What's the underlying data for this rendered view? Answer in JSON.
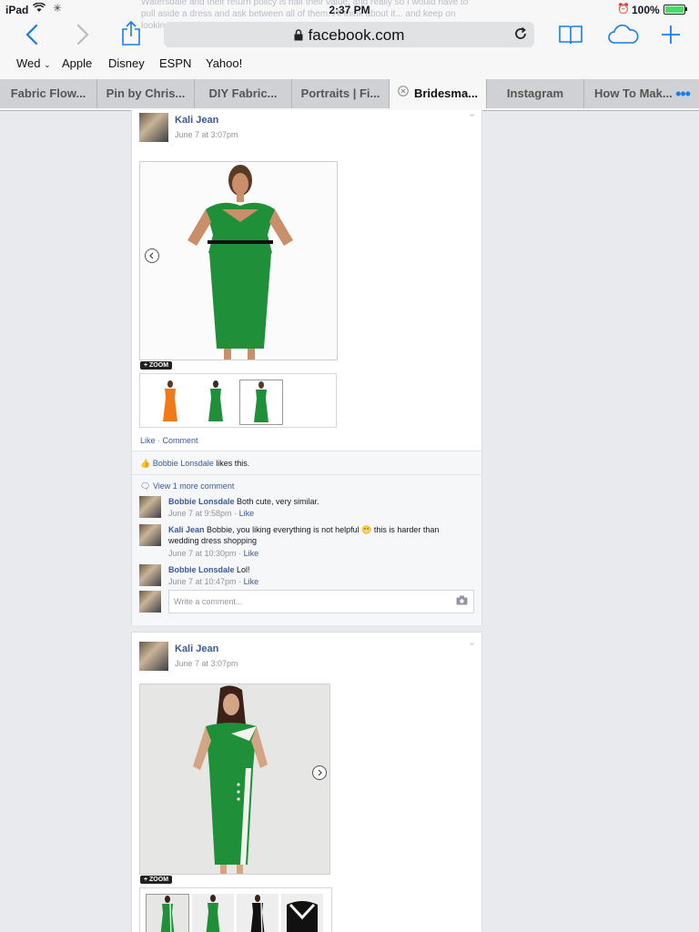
{
  "status_bar": {
    "device": "iPad",
    "time": "2:37 PM",
    "battery": "100%",
    "battery_level": 1.0
  },
  "browser": {
    "address": "facebook.com",
    "background_text": "Watersdale and their return policy is half their value, and really so I would have to pull aside a dress and ask between all of them. I'll think about it... and keep on looking meantime..."
  },
  "favorites": [
    {
      "label": "Wed",
      "has_dropdown": true
    },
    {
      "label": "Apple"
    },
    {
      "label": "Disney"
    },
    {
      "label": "ESPN"
    },
    {
      "label": "Yahoo!"
    }
  ],
  "tabs": [
    {
      "label": "Fabric Flow..."
    },
    {
      "label": "Pin by Chris..."
    },
    {
      "label": "DIY Fabric..."
    },
    {
      "label": "Portraits | Fi..."
    },
    {
      "label": "Bridesma...",
      "active": true
    },
    {
      "label": "Instagram"
    },
    {
      "label": "How To Mak..."
    }
  ],
  "posts": [
    {
      "author": "Kali Jean",
      "time": "June 7 at 3:07pm",
      "zoom_label": "+ ZOOM",
      "actions": {
        "like": "Like",
        "separator": " · ",
        "comment": "Comment"
      },
      "likes": {
        "name": "Bobbie Lonsdale",
        "text": " likes this."
      },
      "view_more": "View 1 more comment",
      "comments": [
        {
          "author": "Bobbie Lonsdale",
          "text": "Both cute, very similar.",
          "time": "June 7 at 9:58pm",
          "like": "Like"
        },
        {
          "author": "Kali Jean",
          "text": "Bobbie, you liking everything is not helpful",
          "emoji": "😬",
          "text2": " this is harder than wedding dress shopping",
          "time": "June 7 at 10:30pm",
          "like": "Like"
        },
        {
          "author": "Bobbie Lonsdale",
          "text": "Lol!",
          "time": "June 7 at 10:47pm",
          "like": "Like"
        }
      ],
      "write_placeholder": "Write a comment..."
    },
    {
      "author": "Kali Jean",
      "time": "June 7 at 3:07pm",
      "zoom_label": "+ ZOOM"
    }
  ],
  "colors": {
    "link_blue": "#3b5998",
    "ios_blue": "#1a7bf0",
    "dress_green": "#1f8f3a",
    "dress_orange": "#f07a1a"
  }
}
